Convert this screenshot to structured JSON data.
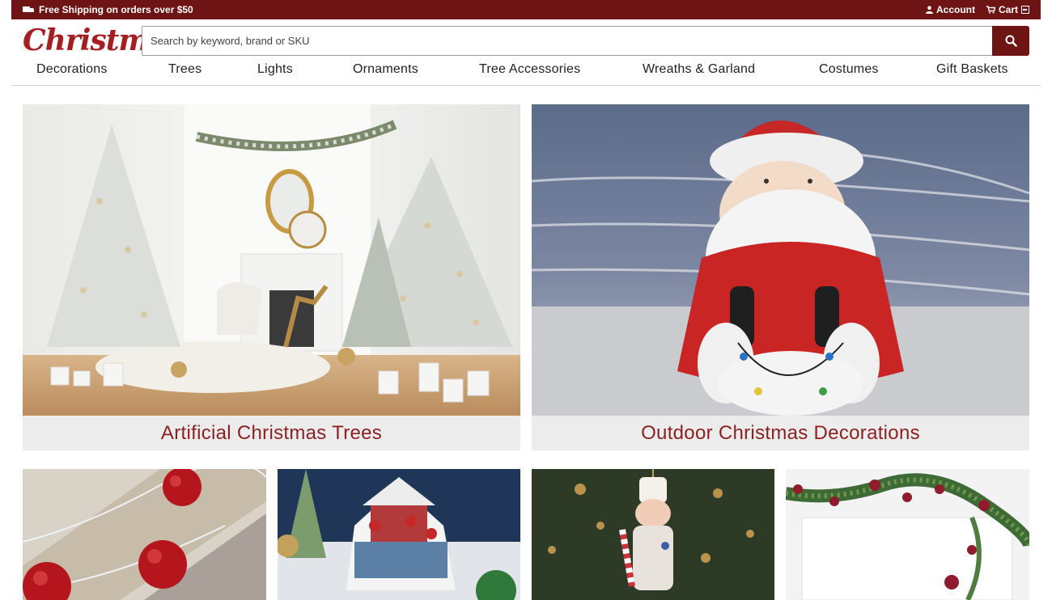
{
  "topbar": {
    "promo_text": "Free Shipping on orders over $50",
    "account_label": "Account",
    "cart_label": "Cart",
    "bg_color": "#6e1414"
  },
  "header": {
    "logo_text": "Christmas",
    "logo_color": "#a51e22"
  },
  "search": {
    "placeholder": "Search by keyword, brand or SKU",
    "button_icon": "search-icon"
  },
  "nav": {
    "items": [
      "Decorations",
      "Trees",
      "Lights",
      "Ornaments",
      "Tree Accessories",
      "Wreaths & Garland",
      "Costumes",
      "Gift Baskets"
    ]
  },
  "featured": [
    {
      "caption": "Artificial Christmas Trees"
    },
    {
      "caption": "Outdoor Christmas Decorations"
    }
  ],
  "colors": {
    "accent": "#8c1f1f",
    "caption_bg": "#ececec"
  }
}
